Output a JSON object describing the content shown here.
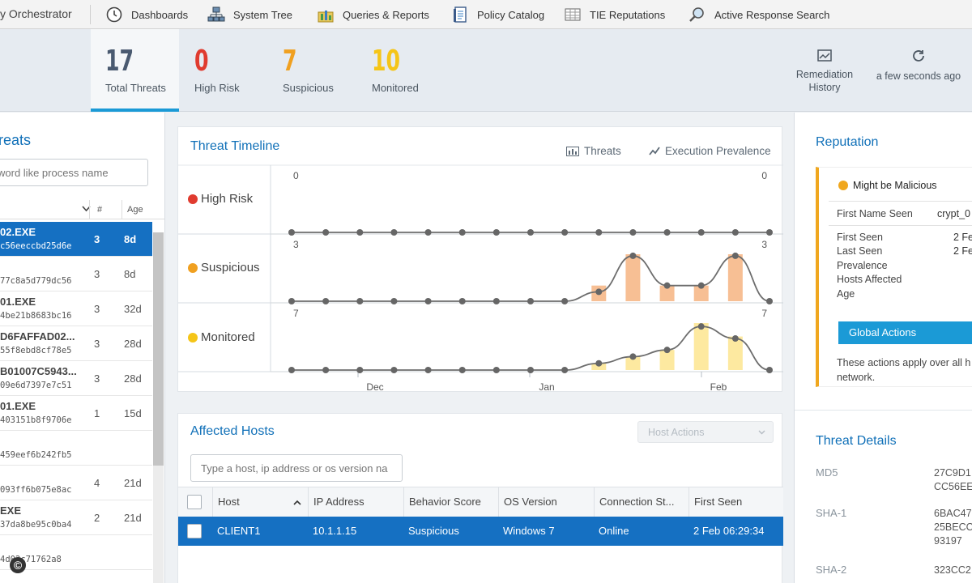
{
  "nav": {
    "brand": "y Orchestrator",
    "items": [
      {
        "label": "Dashboards",
        "icon": "clock-icon"
      },
      {
        "label": "System Tree",
        "icon": "network-icon"
      },
      {
        "label": "Queries & Reports",
        "icon": "chart-folder-icon"
      },
      {
        "label": "Policy Catalog",
        "icon": "document-icon"
      },
      {
        "label": "TIE Reputations",
        "icon": "table-icon"
      },
      {
        "label": "Active Response Search",
        "icon": "search-icon"
      }
    ]
  },
  "summary": {
    "stats": [
      {
        "value": "17",
        "label": "Total Threats",
        "color": "#4a5a70"
      },
      {
        "value": "0",
        "label": "High Risk",
        "color": "#e03b2f"
      },
      {
        "value": "7",
        "label": "Suspicious",
        "color": "#f0a020"
      },
      {
        "value": "10",
        "label": "Monitored",
        "color": "#f5c518"
      }
    ],
    "remediation_label_1": "Remediation",
    "remediation_label_2": "History",
    "refresh_label": "a few seconds ago"
  },
  "threats": {
    "title": "reats",
    "search_placeholder": "word like process name",
    "col_count": "#",
    "col_age": "Age",
    "rows": [
      {
        "name": "02.EXE",
        "hash": "c56eeccbd25d6e",
        "count": "3",
        "age": "8d"
      },
      {
        "name": "",
        "hash": "77c8a5d779dc56",
        "count": "3",
        "age": "8d"
      },
      {
        "name": "01.EXE",
        "hash": "4be21b8683bc16",
        "count": "3",
        "age": "32d"
      },
      {
        "name": "D6FAFFAD02...",
        "hash": "55f8ebd8cf78e5",
        "count": "3",
        "age": "28d"
      },
      {
        "name": "B01007C5943...",
        "hash": "09e6d7397e7c51",
        "count": "3",
        "age": "28d"
      },
      {
        "name": "01.EXE",
        "hash": "403151b8f9706e",
        "count": "1",
        "age": "15d"
      },
      {
        "name": "",
        "hash": "459eef6b242fb5",
        "count": "",
        "age": ""
      },
      {
        "name": "",
        "hash": "093ff6b075e8ac",
        "count": "4",
        "age": "21d"
      },
      {
        "name": "EXE",
        "hash": "37da8be95c0ba4",
        "count": "2",
        "age": "21d"
      },
      {
        "name": "",
        "hash": "4d02c71762a8",
        "count": "",
        "age": ""
      }
    ]
  },
  "timeline": {
    "title": "Threat Timeline",
    "legend_threats": "Threats",
    "legend_prevalence": "Execution Prevalence",
    "lanes": [
      {
        "label": "High Risk",
        "color": "#e03b2f",
        "max_left": "0",
        "max_right": "0"
      },
      {
        "label": "Suspicious",
        "color": "#f0a020",
        "max_left": "3",
        "max_right": "3"
      },
      {
        "label": "Monitored",
        "color": "#f5c518",
        "max_left": "7",
        "max_right": "7"
      }
    ],
    "months": [
      "Dec",
      "Jan",
      "Feb"
    ]
  },
  "chart_data": {
    "type": "bar",
    "title": "Threat Timeline",
    "points": 15,
    "series": [
      {
        "name": "High Risk",
        "ylim": [
          0,
          0
        ],
        "bars": [
          0,
          0,
          0,
          0,
          0,
          0,
          0,
          0,
          0,
          0,
          0,
          0,
          0,
          0,
          0
        ],
        "line": [
          0,
          0,
          0,
          0,
          0,
          0,
          0,
          0,
          0,
          0,
          0,
          0,
          0,
          0,
          0
        ]
      },
      {
        "name": "Suspicious",
        "ylim": [
          0,
          3
        ],
        "bars": [
          0,
          0,
          0,
          0,
          0,
          0,
          0,
          0,
          0,
          1,
          3,
          1,
          1,
          3,
          0
        ],
        "line": [
          0,
          0,
          0,
          0,
          0,
          0,
          0,
          0,
          0,
          0.6,
          2.9,
          1,
          1,
          2.9,
          0
        ]
      },
      {
        "name": "Monitored",
        "ylim": [
          0,
          7
        ],
        "bars": [
          0,
          0,
          0,
          0,
          0,
          0,
          0,
          0,
          0,
          1,
          2,
          3,
          7,
          5,
          0
        ],
        "line": [
          0,
          0,
          0,
          0,
          0,
          0,
          0,
          0,
          0,
          1,
          2,
          3,
          6.5,
          4.7,
          0
        ]
      }
    ],
    "categories": [
      "Dec",
      "Jan",
      "Feb"
    ]
  },
  "hosts": {
    "title": "Affected Hosts",
    "actions_label": "Host Actions",
    "search_placeholder": "Type a host, ip address or os version na",
    "columns": [
      "Host",
      "IP Address",
      "Behavior Score",
      "OS Version",
      "Connection St...",
      "First Seen"
    ],
    "row": {
      "host": "CLIENT1",
      "ip": "10.1.1.15",
      "score": "Suspicious",
      "os": "Windows 7",
      "connection": "Online",
      "first_seen": "2 Feb 06:29:34"
    }
  },
  "reputation": {
    "title": "Reputation",
    "status": "Might be Malicious",
    "first_name_seen_label": "First Name Seen",
    "first_name_seen_value": "crypt_0",
    "first_seen_label": "First Seen",
    "first_seen_value": "2 Fe",
    "last_seen_label": "Last Seen",
    "last_seen_value": "2 Fe",
    "prevalence_label": "Prevalence",
    "hosts_label": "Hosts Affected",
    "age_label": "Age",
    "global_actions": "Global Actions",
    "note_1": "These actions apply over all h",
    "note_2": "network."
  },
  "details": {
    "title": "Threat Details",
    "md5_label": "MD5",
    "md5_1": "27C9D1",
    "md5_2": "CC56EE",
    "sha1_label": "SHA-1",
    "sha1_1": "6BAC47",
    "sha1_2": "25BECC",
    "sha1_3": "93197",
    "sha2_label": "SHA-2",
    "sha2_1": "323CC2"
  }
}
